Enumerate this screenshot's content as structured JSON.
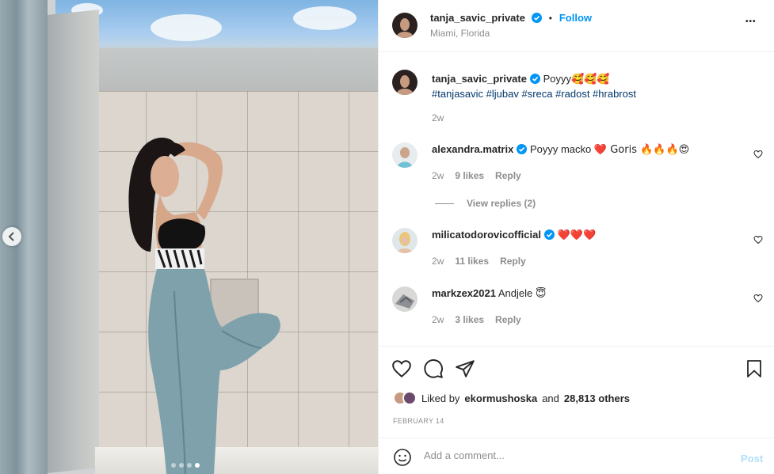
{
  "post": {
    "author": "tanja_savic_private",
    "location": "Miami, Florida",
    "follow_label": "Follow",
    "separator": "•",
    "more_label": "•••"
  },
  "caption": {
    "author": "tanja_savic_private",
    "text": "Poyyy",
    "emojis": "🥰🥰🥰",
    "hashtags": "#tanjasavic #ljubav #sreca #radost #hrabrost",
    "time": "2w"
  },
  "comments": [
    {
      "author": "alexandra.matrix",
      "verified": true,
      "text": "Poyyy macko",
      "emojis": "❤️ Goris 🔥🔥🔥😍",
      "time": "2w",
      "likes": "9 likes",
      "reply": "Reply",
      "view_replies": "View replies (2)"
    },
    {
      "author": "milicatodorovicofficial",
      "verified": true,
      "text": "",
      "emojis": "❤️❤️❤️",
      "time": "2w",
      "likes": "11 likes",
      "reply": "Reply"
    },
    {
      "author": "markzex2021",
      "verified": false,
      "text": "Andjele",
      "emojis": "😇",
      "time": "2w",
      "likes": "3 likes",
      "reply": "Reply"
    }
  ],
  "likes": {
    "prefix": "Liked by",
    "user": "ekormushoska",
    "middle": "and",
    "count": "28,813 others"
  },
  "date": "FEBRUARY 14",
  "add_comment": {
    "placeholder": "Add a comment...",
    "post_label": "Post"
  },
  "carousel": {
    "total": 4,
    "active": 4
  },
  "colors": {
    "accent": "#0095f6",
    "verified": "#0095f6",
    "heart": "#ed4956"
  }
}
